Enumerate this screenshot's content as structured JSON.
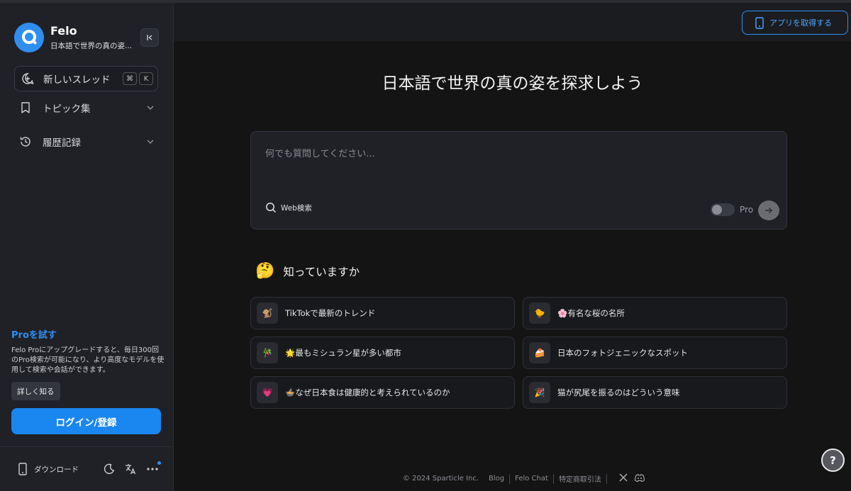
{
  "brand": {
    "name": "Felo",
    "subtitle": "日本語で世界の真の姿..."
  },
  "sidebar": {
    "new_thread": {
      "label": "新しいスレッド",
      "shortcut": [
        "⌘",
        "K"
      ]
    },
    "items": [
      {
        "label": "トピック集",
        "icon": "bookmark-icon"
      },
      {
        "label": "履歴記録",
        "icon": "history-icon"
      }
    ],
    "pro": {
      "title": "Proを試す",
      "description": "Felo Proにアップグレードすると、毎日300回のPro検索が可能になり、より高度なモデルを使用して検索や会話ができます。",
      "learn_more": "詳しく知る",
      "login": "ログイン/登録"
    },
    "footer": {
      "download": "ダウンロード"
    }
  },
  "topbar": {
    "get_app": "アプリを取得する"
  },
  "main": {
    "headline": "日本語で世界の真の姿を探求しよう",
    "search": {
      "placeholder": "何でも質問してください...",
      "web_search": "Web検索",
      "pro_label": "Pro"
    },
    "know": {
      "emoji": "🤔",
      "title": "知っていますか"
    },
    "cards": [
      {
        "emoji": "🐒",
        "label": "TikTokで最新のトレンド"
      },
      {
        "emoji": "🐤",
        "label": "🌸有名な桜の名所"
      },
      {
        "emoji": "🎋",
        "label": "🌟最もミシュラン星が多い都市"
      },
      {
        "emoji": "🍰",
        "label": "日本のフォトジェニックなスポット"
      },
      {
        "emoji": "💗",
        "label": "🍲なぜ日本食は健康的と考えられているのか"
      },
      {
        "emoji": "🎉",
        "label": "猫が尻尾を振るのはどういう意味"
      }
    ]
  },
  "footer": {
    "copyright": "© 2024 Sparticle Inc.",
    "links": [
      "Blog",
      "Felo Chat",
      "特定商取引法"
    ]
  },
  "colors": {
    "accent": "#1a86f0",
    "background": "#141414",
    "sidebar": "#1f2127"
  }
}
